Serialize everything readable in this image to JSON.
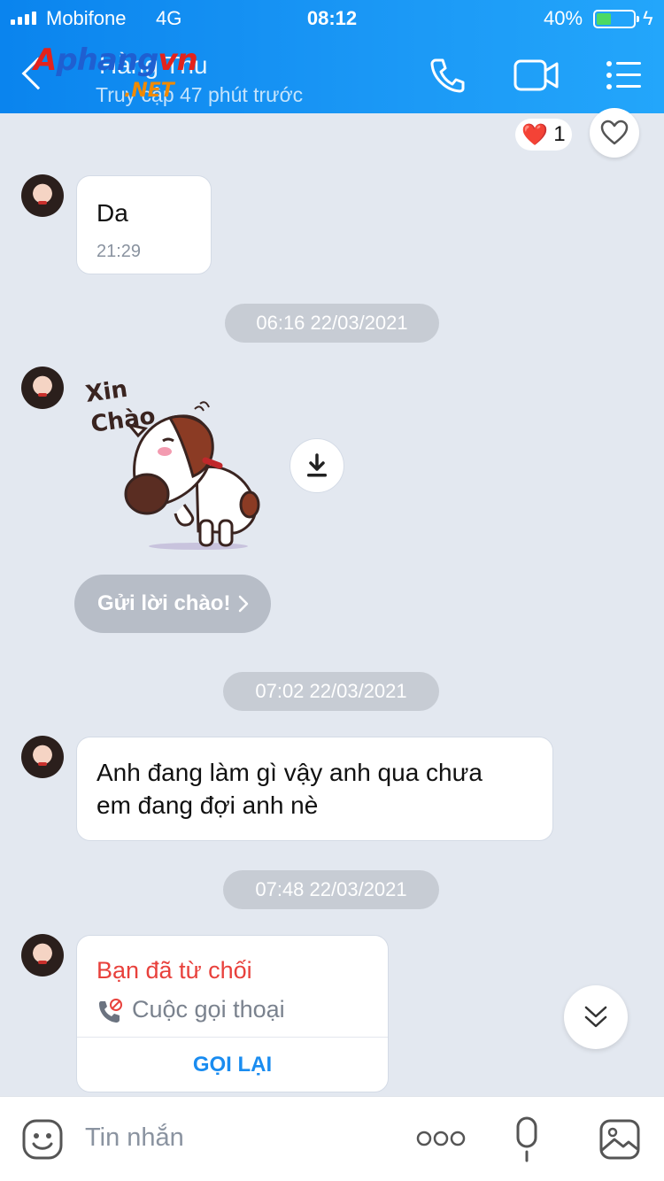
{
  "status_bar": {
    "carrier": "Mobifone",
    "network": "4G",
    "time": "08:12",
    "battery_percent": "40%",
    "battery_level": 0.4
  },
  "header": {
    "logo_main": "Aphangvn",
    "logo_sub": ".NET",
    "contact_name": "Hằng Thu",
    "last_seen": "Truy cập 47 phút trước",
    "icons": [
      "back-icon",
      "phone-icon",
      "video-call-icon",
      "menu-icon"
    ]
  },
  "reaction": {
    "emoji": "❤️",
    "count": "1"
  },
  "messages": [
    {
      "type": "text",
      "text": "Da",
      "time": "21:29"
    },
    {
      "type": "date",
      "text": "06:16 22/03/2021"
    },
    {
      "type": "sticker",
      "sticker_text": "Xin Chào",
      "action": "Gửi lời chào!"
    },
    {
      "type": "date",
      "text": "07:02 22/03/2021"
    },
    {
      "type": "text",
      "line1": "Anh đang làm gì vậy anh qua chưa",
      "line2": "em đang đợi anh nè"
    },
    {
      "type": "date",
      "text": "07:48 22/03/2021"
    },
    {
      "type": "call",
      "title": "Bạn đã từ chối",
      "call_type": "Cuộc gọi thoại",
      "action": "GỌI LẠI"
    }
  ],
  "composer": {
    "placeholder": "Tin nhắn",
    "icons": [
      "emoji-icon",
      "more-icon",
      "microphone-icon",
      "image-icon"
    ]
  },
  "colors": {
    "header_blue": "#1a97f5",
    "declined_red": "#e8413c",
    "callback_blue": "#1a8cf0",
    "chat_background": "#e3e8f0"
  }
}
